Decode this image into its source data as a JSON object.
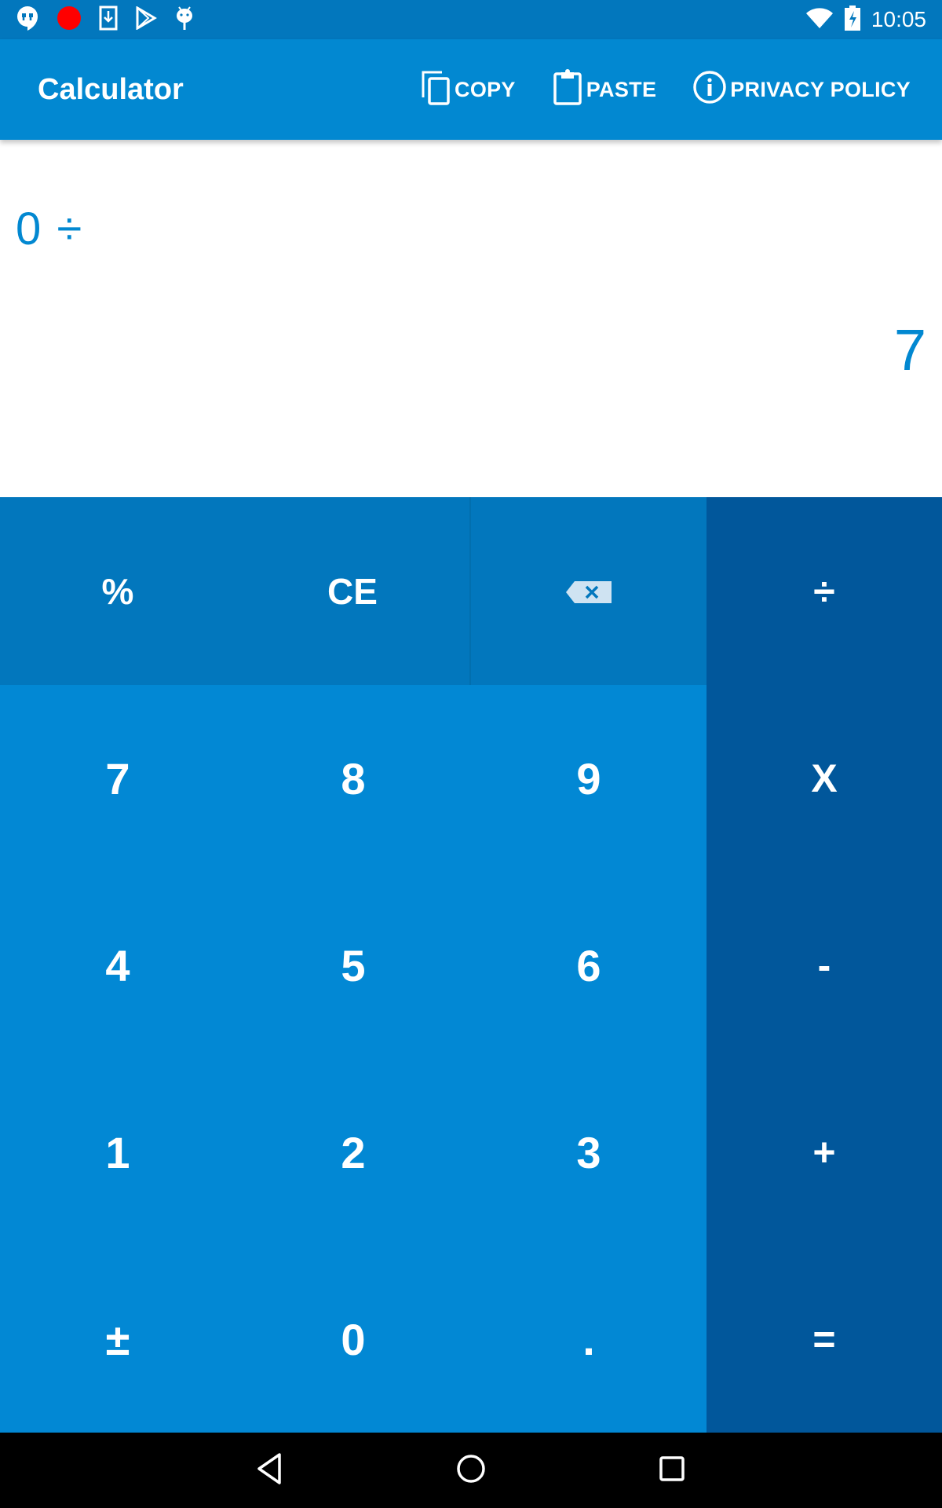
{
  "status_bar": {
    "left_icons": [
      "hangouts-icon",
      "record-icon",
      "download-icon",
      "play-store-icon",
      "android-icon"
    ],
    "right_icons": [
      "wifi-icon",
      "battery-charging-icon"
    ],
    "time": "10:05"
  },
  "app_bar": {
    "title": "Calculator",
    "actions": [
      {
        "label": "COPY",
        "icon": "copy-icon"
      },
      {
        "label": "PASTE",
        "icon": "paste-icon"
      },
      {
        "label": "PRIVACY POLICY",
        "icon": "info-icon"
      }
    ]
  },
  "display": {
    "expression": "0 ÷",
    "result": "7"
  },
  "keypad": {
    "function_row": [
      {
        "label": "%",
        "name": "percent"
      },
      {
        "label": "CE",
        "name": "clear-entry"
      },
      {
        "label": "",
        "name": "backspace",
        "icon": "backspace-icon"
      }
    ],
    "numbers": [
      [
        "7",
        "8",
        "9"
      ],
      [
        "4",
        "5",
        "6"
      ],
      [
        "1",
        "2",
        "3"
      ],
      [
        "±",
        "0",
        "."
      ]
    ],
    "operators": [
      {
        "label": "÷",
        "name": "divide"
      },
      {
        "label": "X",
        "name": "multiply"
      },
      {
        "label": "-",
        "name": "subtract"
      },
      {
        "label": "+",
        "name": "add"
      },
      {
        "label": "=",
        "name": "equals"
      }
    ]
  },
  "nav_bar": {
    "buttons": [
      "back",
      "home",
      "recents"
    ]
  },
  "colors": {
    "status_bar": "#0277bd",
    "app_bar": "#0288d1",
    "display_text": "#0288d1",
    "function_keys": "#0277bd",
    "number_keys": "#0288d4",
    "operator_keys": "#01579b",
    "nav_bar": "#000000"
  }
}
